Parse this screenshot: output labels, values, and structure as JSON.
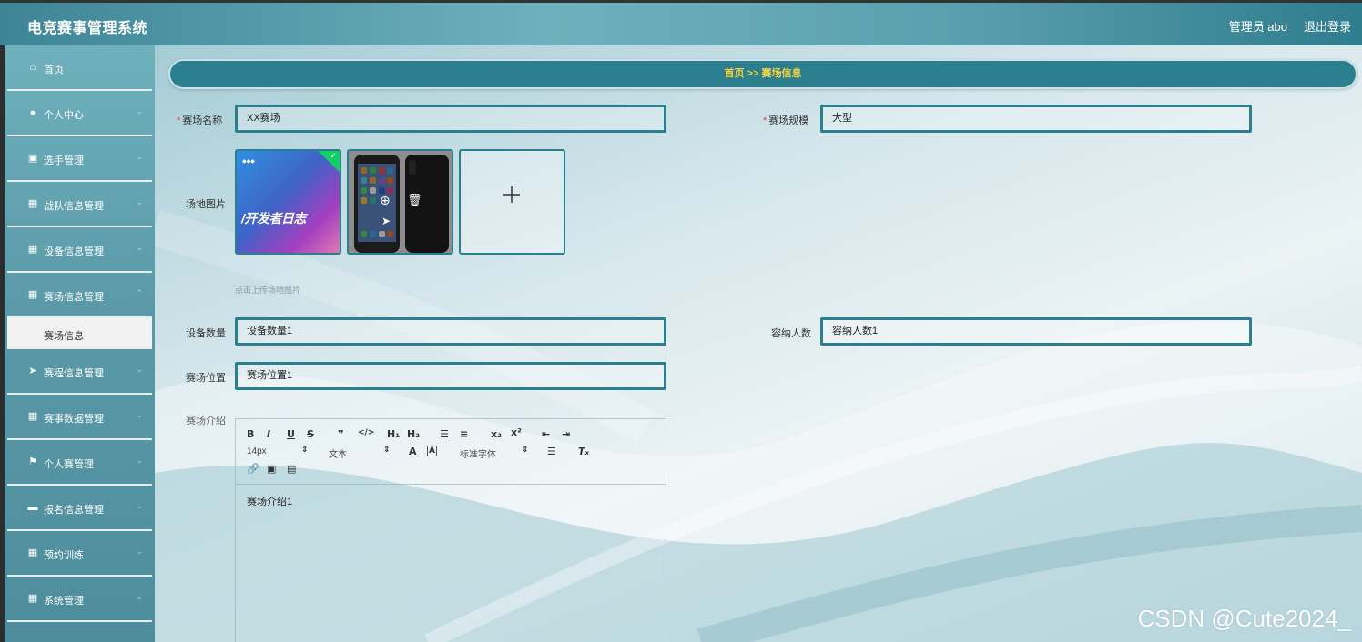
{
  "header": {
    "title": "电竞赛事管理系统",
    "user": "管理员 abo",
    "logout": "退出登录"
  },
  "sidebar": {
    "items": [
      {
        "label": "首页",
        "icon": "home-icon",
        "glyph": "⌂"
      },
      {
        "label": "个人中心",
        "icon": "user-icon",
        "glyph": "●"
      },
      {
        "label": "选手管理",
        "icon": "clipboard-icon",
        "glyph": "▣"
      },
      {
        "label": "战队信息管理",
        "icon": "grid-icon",
        "glyph": "▦"
      },
      {
        "label": "设备信息管理",
        "icon": "grid-icon",
        "glyph": "▦"
      },
      {
        "label": "赛场信息管理",
        "icon": "grid-icon",
        "glyph": "▦"
      },
      {
        "label": "赛程信息管理",
        "icon": "send-icon",
        "glyph": "➤"
      },
      {
        "label": "赛事数据管理",
        "icon": "grid-icon",
        "glyph": "▦"
      },
      {
        "label": "个人赛管理",
        "icon": "flag-icon",
        "glyph": "⚑"
      },
      {
        "label": "报名信息管理",
        "icon": "printer-icon",
        "glyph": "▬"
      },
      {
        "label": "预约训练",
        "icon": "grid-icon",
        "glyph": "▦"
      },
      {
        "label": "系统管理",
        "icon": "grid-icon",
        "glyph": "▦"
      }
    ],
    "active_sub": "赛场信息"
  },
  "breadcrumb": "首页  >>  赛场信息",
  "form": {
    "venue_name_label": "赛场名称",
    "venue_name_value": "XX赛场",
    "venue_scale_label": "赛场规模",
    "venue_scale_value": "大型",
    "venue_image_label": "场地图片",
    "tile1_text": "/开发者日志",
    "upload_hint": "点击上传场地图片",
    "equipment_count_label": "设备数量",
    "equipment_count_value": "设备数量1",
    "capacity_label": "容纳人数",
    "capacity_value": "容纳人数1",
    "location_label": "赛场位置",
    "location_value": "赛场位置1",
    "intro_label": "赛场介绍",
    "intro_value": "赛场介绍1"
  },
  "editor_toolbar": {
    "font_size": "14px",
    "format": "文本",
    "font_family": "标准字体"
  },
  "watermark": "CSDN @Cute2024_",
  "colors": {
    "accent": "#2c7f8f",
    "breadcrumb_text": "#f5d442",
    "required": "#e64242",
    "check": "#13ce66"
  }
}
